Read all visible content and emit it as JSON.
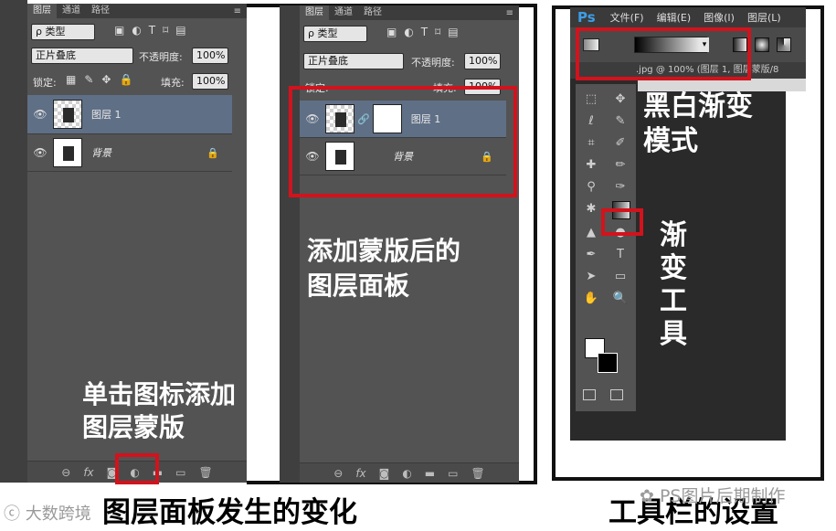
{
  "left_panel": {
    "tabs": [
      "图层",
      "通道",
      "路径"
    ],
    "filter_label": "ρ 类型",
    "blend_mode": "正片叠底",
    "opacity_label": "不透明度:",
    "opacity_value": "100%",
    "lock_label": "锁定:",
    "fill_label": "填充:",
    "fill_value": "100%",
    "layers": [
      {
        "name": "图层 1"
      },
      {
        "name": "背景"
      }
    ],
    "annotation": "单击图标添加\n图层蒙版"
  },
  "middle_panel": {
    "tabs": [
      "图层",
      "通道",
      "路径"
    ],
    "filter_label": "ρ 类型",
    "blend_mode": "正片叠底",
    "opacity_label": "不透明度:",
    "opacity_value": "100%",
    "lock_label": "锁定:",
    "fill_label": "填充:",
    "fill_value": "100%",
    "layers": [
      {
        "name": "图层 1"
      },
      {
        "name": "背景"
      }
    ],
    "annotation": "添加蒙版后的\n图层面板"
  },
  "right_panel": {
    "ps_logo": "Ps",
    "menu": [
      "文件(F)",
      "编辑(E)",
      "图像(I)",
      "图层(L)"
    ],
    "doc_tab": ".jpg @ 100% (图层 1, 图层蒙版/8",
    "annotation_mode": "黑白渐变\n模式",
    "annotation_tool": "渐\n变\n工\n具"
  },
  "captions": {
    "left": "图层面板发生的变化",
    "right": "工具栏的设置",
    "watermark_left": "大数跨境",
    "watermark_right": "PS图片后期制作"
  },
  "colors": {
    "accent_red": "#d3121c",
    "panel": "#535353",
    "selected_layer": "#5f6f86"
  }
}
